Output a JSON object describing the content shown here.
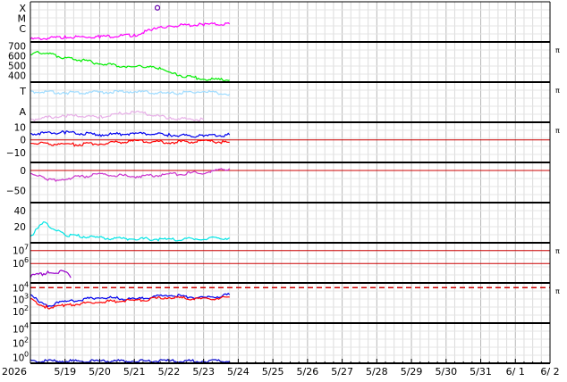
{
  "chart_data": {
    "type": "line",
    "date_axis": {
      "year_label": "2026",
      "tick_labels": [
        "5/19",
        "5/20",
        "5/21",
        "5/22",
        "5/23",
        "5/24",
        "5/25",
        "5/26",
        "5/27",
        "5/28",
        "5/29",
        "5/30",
        "5/31",
        "6/ 1",
        "6/ 2"
      ],
      "range": [
        "2026-05-18",
        "2026-06-02"
      ]
    },
    "grid": true,
    "panels": [
      {
        "id": "xray",
        "y_labels": [
          "X",
          "M",
          "C"
        ],
        "ylim": [
          0,
          3
        ],
        "series": [
          {
            "color": "#ff00ff",
            "x": [
              "2026-05-18",
              "2026-05-19",
              "2026-05-20",
              "2026-05-21",
              "2026-05-21T12:00",
              "2026-05-22",
              "2026-05-23",
              "2026-05-23T18:00"
            ],
            "y": [
              0.2,
              0.35,
              0.4,
              0.5,
              0.9,
              1.2,
              1.3,
              1.35
            ]
          }
        ],
        "markers": [
          {
            "x": "2026-05-21T16:00",
            "y": 2.55
          }
        ],
        "right_label": ""
      },
      {
        "id": "wind-speed",
        "y_ticks": [
          400,
          500,
          600,
          700
        ],
        "ylim": [
          330,
          740
        ],
        "series": [
          {
            "color": "#00ee00",
            "x": [
              "2026-05-18",
              "2026-05-18T06:00",
              "2026-05-19",
              "2026-05-20",
              "2026-05-21",
              "2026-05-21T12:00",
              "2026-05-22",
              "2026-05-23",
              "2026-05-23T18:00"
            ],
            "y": [
              600,
              640,
              580,
              520,
              480,
              500,
              420,
              360,
              350
            ]
          }
        ],
        "right_label": "π"
      },
      {
        "id": "mag-t",
        "y_labels": [
          "T",
          "A"
        ],
        "ylim": [
          0,
          3
        ],
        "series": [
          {
            "color": "#9fdcff",
            "x": [
              "2026-05-18",
              "2026-05-19",
              "2026-05-20",
              "2026-05-21",
              "2026-05-22",
              "2026-05-23",
              "2026-05-23T18:00"
            ],
            "y": [
              2.3,
              2.2,
              2.25,
              2.3,
              2.15,
              2.3,
              2.1
            ]
          },
          {
            "color": "#e8b0e8",
            "x": [
              "2026-05-18",
              "2026-05-19",
              "2026-05-20",
              "2026-05-21",
              "2026-05-22",
              "2026-05-23"
            ],
            "y": [
              0.2,
              0.5,
              0.4,
              0.8,
              0.3,
              0.2
            ]
          }
        ],
        "right_label": "π"
      },
      {
        "id": "bz",
        "y_ticks": [
          10,
          0,
          -10
        ],
        "ylim": [
          -18,
          14
        ],
        "zero_line": 0,
        "series": [
          {
            "color": "#0000ee",
            "x": [
              "2026-05-18",
              "2026-05-19",
              "2026-05-20",
              "2026-05-21",
              "2026-05-22",
              "2026-05-23",
              "2026-05-23T18:00"
            ],
            "y": [
              5,
              6,
              4,
              5,
              4,
              3,
              4
            ]
          },
          {
            "color": "#ff0000",
            "x": [
              "2026-05-18",
              "2026-05-19",
              "2026-05-20",
              "2026-05-21",
              "2026-05-22",
              "2026-05-23",
              "2026-05-23T18:00"
            ],
            "y": [
              -2,
              -4,
              -3,
              -1,
              -2,
              -1,
              -2
            ]
          }
        ],
        "right_label": "π"
      },
      {
        "id": "phi",
        "y_ticks": [
          0,
          -50
        ],
        "ylim": [
          -80,
          20
        ],
        "zero_line": 0,
        "series": [
          {
            "color": "#cc33cc",
            "x": [
              "2026-05-18",
              "2026-05-18T12:00",
              "2026-05-19",
              "2026-05-20",
              "2026-05-21",
              "2026-05-22",
              "2026-05-23",
              "2026-05-23T18:00"
            ],
            "y": [
              -5,
              -25,
              -20,
              -10,
              -15,
              -10,
              -5,
              5
            ]
          }
        ],
        "right_label": ""
      },
      {
        "id": "density",
        "y_ticks": [
          40,
          20
        ],
        "ylim": [
          0,
          50
        ],
        "series": [
          {
            "color": "#00e5e5",
            "x": [
              "2026-05-18",
              "2026-05-18T09:00",
              "2026-05-19",
              "2026-05-20",
              "2026-05-21",
              "2026-05-22",
              "2026-05-23",
              "2026-05-23T18:00"
            ],
            "y": [
              8,
              25,
              10,
              6,
              5,
              4,
              5,
              6
            ]
          }
        ],
        "right_label": ""
      },
      {
        "id": "electron-flux",
        "y_tick_exponents": [
          7,
          6
        ],
        "ylim_log10": [
          4.5,
          7.6
        ],
        "ref_lines_log10": [
          7.0,
          6.0
        ],
        "series": [
          {
            "color": "#9900cc",
            "x": [
              "2026-05-18",
              "2026-05-18T12:00",
              "2026-05-19",
              "2026-05-19T04:00"
            ],
            "y_log10": [
              5.0,
              5.3,
              5.4,
              4.9
            ]
          }
        ],
        "right_label": "π"
      },
      {
        "id": "proton-flux",
        "y_tick_exponents": [
          4,
          3,
          2
        ],
        "ylim_log10": [
          1.0,
          4.4
        ],
        "dashed_line_log10": 4.0,
        "series": [
          {
            "color": "#0000ee",
            "x": [
              "2026-05-18",
              "2026-05-18T12:00",
              "2026-05-19",
              "2026-05-20",
              "2026-05-21",
              "2026-05-22",
              "2026-05-23",
              "2026-05-23T18:00"
            ],
            "y_log10": [
              3.3,
              2.5,
              2.8,
              3.2,
              3.0,
              3.4,
              3.1,
              3.4
            ]
          },
          {
            "color": "#ff0000",
            "x": [
              "2026-05-18",
              "2026-05-18T12:00",
              "2026-05-19",
              "2026-05-20",
              "2026-05-21",
              "2026-05-22",
              "2026-05-23",
              "2026-05-23T18:00"
            ],
            "y_log10": [
              3.0,
              2.3,
              2.5,
              2.8,
              2.9,
              3.2,
              3.0,
              3.2
            ]
          }
        ],
        "right_label": "π"
      },
      {
        "id": "neutron",
        "y_tick_exponents": [
          4,
          2,
          0
        ],
        "ylim_log10": [
          -0.8,
          4.8
        ],
        "series": [
          {
            "color": "#0000cc",
            "x": [
              "2026-05-18",
              "2026-05-19",
              "2026-05-20",
              "2026-05-21",
              "2026-05-22",
              "2026-05-23",
              "2026-05-23T18:00"
            ],
            "y_log10": [
              -0.5,
              -0.5,
              -0.5,
              -0.5,
              -0.5,
              -0.5,
              -0.5
            ]
          }
        ],
        "right_label": ""
      }
    ]
  }
}
